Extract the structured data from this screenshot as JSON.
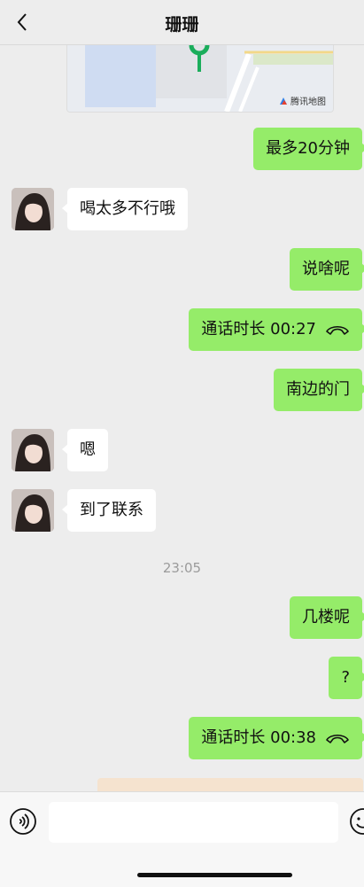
{
  "header": {
    "title": "珊珊",
    "back_icon": "chevron-left-icon"
  },
  "map_card": {
    "credit": "腾讯地图",
    "pin_icon": "map-pin-icon"
  },
  "messages": [
    {
      "side": "out",
      "text": "最多20分钟"
    },
    {
      "side": "in",
      "text": "喝太多不行哦"
    },
    {
      "side": "out",
      "text": "说啥呢"
    },
    {
      "side": "out",
      "type": "call",
      "text": "通话时长 00:27",
      "icon": "phone-hangup-icon"
    },
    {
      "side": "out",
      "text": "南边的门"
    },
    {
      "side": "in",
      "text": "嗯"
    },
    {
      "side": "in",
      "text": "到了联系"
    },
    {
      "side": "out",
      "text": "几楼呢"
    },
    {
      "side": "out",
      "text": "?"
    },
    {
      "side": "out",
      "type": "call",
      "text": "通话时长 00:38",
      "icon": "phone-hangup-icon"
    }
  ],
  "timestamp": "23:05",
  "input_bar": {
    "voice_icon": "voice-icon",
    "text_value": "",
    "emoji_icon": "emoji-icon"
  },
  "colors": {
    "outgoing": "#95ec69",
    "incoming": "#ffffff",
    "background": "#ededed"
  }
}
